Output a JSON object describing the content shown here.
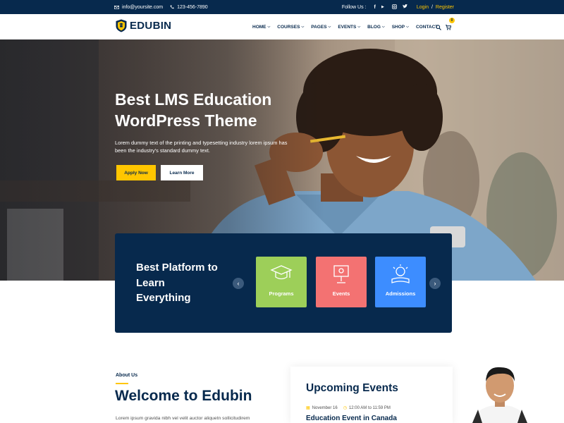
{
  "topbar": {
    "email": "info@yoursite.com",
    "phone": "123-456-7890",
    "follow_label": "Follow Us :",
    "social": [
      "facebook-icon",
      "youtube-icon",
      "instagram-icon",
      "twitter-icon"
    ],
    "login": "Login",
    "separator": "/",
    "register": "Register"
  },
  "header": {
    "logo_text": "EDUBIN",
    "nav": [
      {
        "label": "HOME",
        "dropdown": true
      },
      {
        "label": "COURSES",
        "dropdown": true
      },
      {
        "label": "PAGES",
        "dropdown": true
      },
      {
        "label": "EVENTS",
        "dropdown": true
      },
      {
        "label": "BLOG",
        "dropdown": true
      },
      {
        "label": "SHOP",
        "dropdown": true
      },
      {
        "label": "CONTACT",
        "dropdown": false
      }
    ],
    "cart_count": "0"
  },
  "hero": {
    "title": "Best LMS Education WordPress Theme",
    "subtitle": "Lorem dummy text of the printing and typesetting industry lorem ipsum has been the industry's standard dummy text.",
    "apply_label": "Apply Now",
    "learn_label": "Learn More"
  },
  "platform": {
    "title": "Best Platform to Learn Everything",
    "cards": [
      {
        "label": "Programs",
        "color": "#9dcf59",
        "icon": "graduation-cap-icon"
      },
      {
        "label": "Events",
        "color": "#f37272",
        "icon": "presentation-icon"
      },
      {
        "label": "Admissions",
        "color": "#3d8dff",
        "icon": "lightbulb-icon"
      }
    ]
  },
  "about": {
    "label": "About Us",
    "title": "Welcome to Edubin",
    "text": "Lorem ipsum gravida nibh vel velit auctor aliquetn sollicitudirem"
  },
  "events": {
    "title": "Upcoming Events",
    "date": "November 16",
    "time": "12:00 AM to 11:59 PM",
    "event_name": "Education Event in Canada"
  },
  "colors": {
    "navy": "#07294d",
    "accent": "#ffc600"
  }
}
